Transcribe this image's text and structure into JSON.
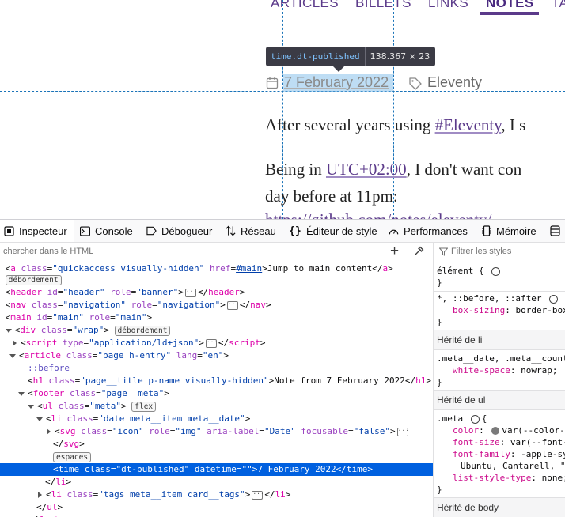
{
  "page": {
    "nav": [
      "ARTICLES",
      "BILLETS",
      "LINKS",
      "NOTES",
      "TA"
    ],
    "active_nav": "NOTES",
    "tooltip": {
      "selector": "time.dt-published",
      "dimensions": "138.367 × 23"
    },
    "meta": {
      "date": "7 February 2022",
      "tag": "Eleventy"
    },
    "para1": {
      "before": "After several years using ",
      "link": "#Eleventy",
      "after": ", I s"
    },
    "para2": {
      "before": "Being in ",
      "link": "UTC+02:00",
      "after": ", I don't want con"
    },
    "para3": "day before at 11pm:",
    "para4_link": "https://github.com/notes/eleventy/"
  },
  "devtools": {
    "tabs": [
      "Inspecteur",
      "Console",
      "Débogueur",
      "Réseau",
      "Éditeur de style",
      "Performances",
      "Mémoire"
    ],
    "search_placeholder": "chercher dans le HTML",
    "rules_filter_placeholder": "Filtrer les styles",
    "markup": {
      "l1_text": "Jump to main content",
      "badge_debordement": "débordement",
      "badge_flex": "flex",
      "badge_espaces": "espaces",
      "h1_text": "Note from 7 February 2022",
      "time_text": "7 February 2022",
      "attr_main_href": "#main",
      "pseudo_before": "::before"
    },
    "rules": {
      "element_selector": "élément {",
      "close_brace": "}",
      "universal_selector": "*, ::before, ::after",
      "universal_prop": "box-sizing",
      "universal_val": "border-box",
      "inherited_li": "Hérité de li",
      "li_selector": ".meta__date, .meta__count",
      "li_prop": "white-space",
      "li_val": "nowrap;",
      "inherited_ul": "Hérité de ul",
      "ul_selector": ".meta",
      "ul_color_prop": "color",
      "ul_color_val": "var(--color-",
      "ul_fontsize_prop": "font-size",
      "ul_fontsize_val": "var(--font-",
      "ul_fontfamily_prop": "font-family",
      "ul_fontfamily_val": "-apple-sy",
      "ul_fontfamily_cont": "Ubuntu, Cantarell, \"",
      "ul_liststyle_prop": "list-style-type",
      "ul_liststyle_val": "none;",
      "inherited_body": "Hérité de body"
    }
  }
}
